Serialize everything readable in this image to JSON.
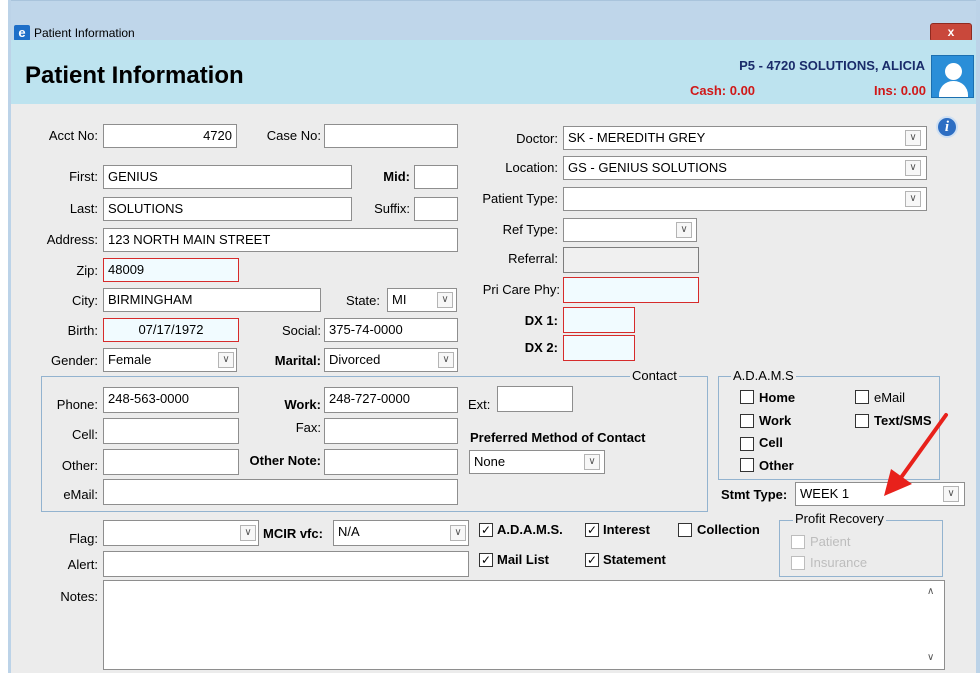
{
  "window": {
    "title": "Patient Information",
    "app_icon": "e",
    "close": "x"
  },
  "header": {
    "title": "Patient Information",
    "patient_name": "P5 - 4720 SOLUTIONS, ALICIA",
    "cash": "Cash: 0.00",
    "ins": "Ins: 0.00",
    "info_icon": "i"
  },
  "form": {
    "acct_label": "Acct No:",
    "acct_value": "4720",
    "case_label": "Case No:",
    "case_value": "",
    "first_label": "First:",
    "first_value": "GENIUS",
    "mid_label": "Mid:",
    "mid_value": "",
    "last_label": "Last:",
    "last_value": "SOLUTIONS",
    "suffix_label": "Suffix:",
    "suffix_value": "",
    "address_label": "Address:",
    "address_value": "123 NORTH MAIN STREET",
    "zip_label": "Zip:",
    "zip_value": "48009",
    "city_label": "City:",
    "city_value": "BIRMINGHAM",
    "state_label": "State:",
    "state_value": "MI",
    "birth_label": "Birth:",
    "birth_value": "07/17/1972",
    "social_label": "Social:",
    "social_value": "375-74-0000",
    "gender_label": "Gender:",
    "gender_value": "Female",
    "marital_label": "Marital:",
    "marital_value": "Divorced",
    "doctor_label": "Doctor:",
    "doctor_value": "SK - MEREDITH GREY",
    "location_label": "Location:",
    "location_value": "GS - GENIUS SOLUTIONS",
    "patient_type_label": "Patient Type:",
    "patient_type_value": "",
    "ref_type_label": "Ref Type:",
    "ref_type_value": "",
    "referral_label": "Referral:",
    "referral_value": "",
    "pri_care_label": "Pri Care Phy:",
    "pri_care_value": "",
    "dx1_label": "DX 1:",
    "dx1_value": "",
    "dx2_label": "DX 2:",
    "dx2_value": ""
  },
  "contact": {
    "title": "Contact",
    "phone_label": "Phone:",
    "phone_value": "248-563-0000",
    "work_label": "Work:",
    "work_value": "248-727-0000",
    "ext_label": "Ext:",
    "ext_value": "",
    "cell_label": "Cell:",
    "cell_value": "",
    "fax_label": "Fax:",
    "fax_value": "",
    "other_label": "Other:",
    "other_value": "",
    "other_note_label": "Other Note:",
    "other_note_value": "",
    "email_label": "eMail:",
    "email_value": "",
    "preferred_label": "Preferred Method of Contact",
    "preferred_value": "None"
  },
  "adams": {
    "title": "A.D.A.M.S",
    "home": "Home",
    "work": "Work",
    "cell": "Cell",
    "other": "Other",
    "email": "eMail",
    "text_sms": "Text/SMS"
  },
  "stmt": {
    "label": "Stmt Type:",
    "value": "WEEK 1"
  },
  "bottom": {
    "flag_label": "Flag:",
    "flag_value": "",
    "mcir_label": "MCIR vfc:",
    "mcir_value": "N/A",
    "alert_label": "Alert:",
    "alert_value": "",
    "notes_label": "Notes:",
    "cb_adams": "A.D.A.M.S.",
    "cb_interest": "Interest",
    "cb_collection": "Collection",
    "cb_mail_list": "Mail List",
    "cb_statement": "Statement",
    "check_mark": "✓"
  },
  "profit_recovery": {
    "title": "Profit Recovery",
    "patient": "Patient",
    "insurance": "Insurance"
  },
  "icons": {
    "dropdown": "chevron-down-icon",
    "close": "close-icon",
    "info": "info-icon",
    "avatar": "user-avatar-icon"
  },
  "colors": {
    "header_bg": "#bde3ef",
    "titlebar": "#bfd6ea",
    "alert_red": "#d01818",
    "arrow_red": "#e8211b",
    "group_border": "#93b3cf"
  }
}
